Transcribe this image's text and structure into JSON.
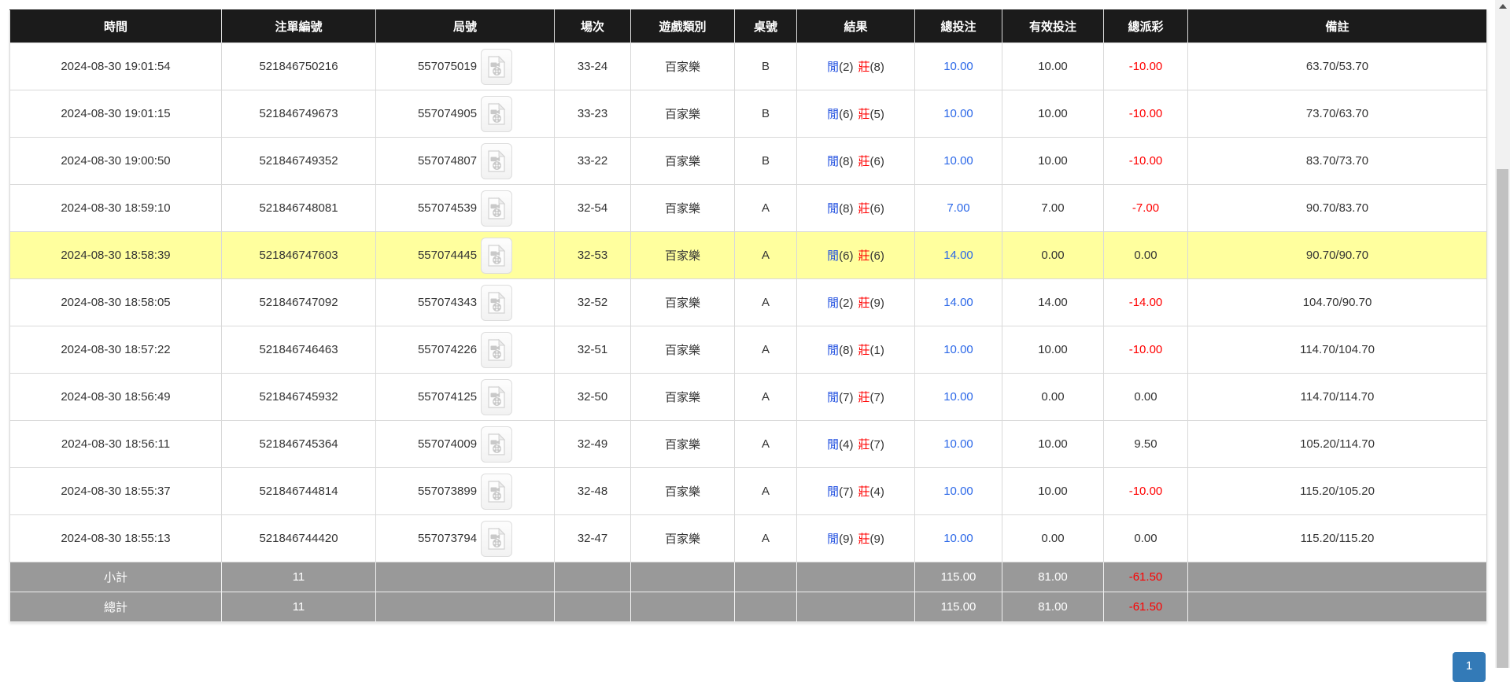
{
  "colors": {
    "header_bg": "#1b1b1b",
    "highlight_yellow": "#ffff9e",
    "bet_blue": "#2c68e8",
    "player_blue": "#2150e0",
    "banker_red": "#ff0000",
    "negative_red": "#ff0000",
    "summary_bg": "#999999",
    "pagination_blue": "#337ab7"
  },
  "icons": {
    "round_video": "video-file-icon",
    "scrollbar_up": "up-arrow-icon"
  },
  "pagination": {
    "current_page": "1"
  },
  "table": {
    "columns": [
      {
        "key": "time",
        "label": "時間"
      },
      {
        "key": "bet_id",
        "label": "注單編號"
      },
      {
        "key": "round",
        "label": "局號"
      },
      {
        "key": "session",
        "label": "場次"
      },
      {
        "key": "game_type",
        "label": "遊戲類別"
      },
      {
        "key": "table_no",
        "label": "桌號"
      },
      {
        "key": "result",
        "label": "結果"
      },
      {
        "key": "total_bet",
        "label": "總投注"
      },
      {
        "key": "valid_bet",
        "label": "有效投注"
      },
      {
        "key": "total_payout",
        "label": "總派彩"
      },
      {
        "key": "remark",
        "label": "備註"
      }
    ],
    "rows": [
      {
        "time": "2024-08-30 19:01:54",
        "bet_id": "521846750216",
        "round": "557075019",
        "session": "33-24",
        "game_type": "百家樂",
        "table_no": "B",
        "result": {
          "player_label": "閒",
          "player": "(2)",
          "banker_label": "莊",
          "banker": "(8)"
        },
        "total_bet": "10.00",
        "valid_bet": "10.00",
        "total_payout": "-10.00",
        "remark": "63.70/53.70",
        "highlighted": false
      },
      {
        "time": "2024-08-30 19:01:15",
        "bet_id": "521846749673",
        "round": "557074905",
        "session": "33-23",
        "game_type": "百家樂",
        "table_no": "B",
        "result": {
          "player_label": "閒",
          "player": "(6)",
          "banker_label": "莊",
          "banker": "(5)"
        },
        "total_bet": "10.00",
        "valid_bet": "10.00",
        "total_payout": "-10.00",
        "remark": "73.70/63.70",
        "highlighted": false
      },
      {
        "time": "2024-08-30 19:00:50",
        "bet_id": "521846749352",
        "round": "557074807",
        "session": "33-22",
        "game_type": "百家樂",
        "table_no": "B",
        "result": {
          "player_label": "閒",
          "player": "(8)",
          "banker_label": "莊",
          "banker": "(6)"
        },
        "total_bet": "10.00",
        "valid_bet": "10.00",
        "total_payout": "-10.00",
        "remark": "83.70/73.70",
        "highlighted": false
      },
      {
        "time": "2024-08-30 18:59:10",
        "bet_id": "521846748081",
        "round": "557074539",
        "session": "32-54",
        "game_type": "百家樂",
        "table_no": "A",
        "result": {
          "player_label": "閒",
          "player": "(8)",
          "banker_label": "莊",
          "banker": "(6)"
        },
        "total_bet": "7.00",
        "valid_bet": "7.00",
        "total_payout": "-7.00",
        "remark": "90.70/83.70",
        "highlighted": false
      },
      {
        "time": "2024-08-30 18:58:39",
        "bet_id": "521846747603",
        "round": "557074445",
        "session": "32-53",
        "game_type": "百家樂",
        "table_no": "A",
        "result": {
          "player_label": "閒",
          "player": "(6)",
          "banker_label": "莊",
          "banker": "(6)"
        },
        "total_bet": "14.00",
        "valid_bet": "0.00",
        "total_payout": "0.00",
        "remark": "90.70/90.70",
        "highlighted": true
      },
      {
        "time": "2024-08-30 18:58:05",
        "bet_id": "521846747092",
        "round": "557074343",
        "session": "32-52",
        "game_type": "百家樂",
        "table_no": "A",
        "result": {
          "player_label": "閒",
          "player": "(2)",
          "banker_label": "莊",
          "banker": "(9)"
        },
        "total_bet": "14.00",
        "valid_bet": "14.00",
        "total_payout": "-14.00",
        "remark": "104.70/90.70",
        "highlighted": false
      },
      {
        "time": "2024-08-30 18:57:22",
        "bet_id": "521846746463",
        "round": "557074226",
        "session": "32-51",
        "game_type": "百家樂",
        "table_no": "A",
        "result": {
          "player_label": "閒",
          "player": "(8)",
          "banker_label": "莊",
          "banker": "(1)"
        },
        "total_bet": "10.00",
        "valid_bet": "10.00",
        "total_payout": "-10.00",
        "remark": "114.70/104.70",
        "highlighted": false
      },
      {
        "time": "2024-08-30 18:56:49",
        "bet_id": "521846745932",
        "round": "557074125",
        "session": "32-50",
        "game_type": "百家樂",
        "table_no": "A",
        "result": {
          "player_label": "閒",
          "player": "(7)",
          "banker_label": "莊",
          "banker": "(7)"
        },
        "total_bet": "10.00",
        "valid_bet": "0.00",
        "total_payout": "0.00",
        "remark": "114.70/114.70",
        "highlighted": false
      },
      {
        "time": "2024-08-30 18:56:11",
        "bet_id": "521846745364",
        "round": "557074009",
        "session": "32-49",
        "game_type": "百家樂",
        "table_no": "A",
        "result": {
          "player_label": "閒",
          "player": "(4)",
          "banker_label": "莊",
          "banker": "(7)"
        },
        "total_bet": "10.00",
        "valid_bet": "10.00",
        "total_payout": "9.50",
        "remark": "105.20/114.70",
        "highlighted": false
      },
      {
        "time": "2024-08-30 18:55:37",
        "bet_id": "521846744814",
        "round": "557073899",
        "session": "32-48",
        "game_type": "百家樂",
        "table_no": "A",
        "result": {
          "player_label": "閒",
          "player": "(7)",
          "banker_label": "莊",
          "banker": "(4)"
        },
        "total_bet": "10.00",
        "valid_bet": "10.00",
        "total_payout": "-10.00",
        "remark": "115.20/105.20",
        "highlighted": false
      },
      {
        "time": "2024-08-30 18:55:13",
        "bet_id": "521846744420",
        "round": "557073794",
        "session": "32-47",
        "game_type": "百家樂",
        "table_no": "A",
        "result": {
          "player_label": "閒",
          "player": "(9)",
          "banker_label": "莊",
          "banker": "(9)"
        },
        "total_bet": "10.00",
        "valid_bet": "0.00",
        "total_payout": "0.00",
        "remark": "115.20/115.20",
        "highlighted": false
      }
    ],
    "summary": [
      {
        "label": "小計",
        "count": "11",
        "total_bet": "115.00",
        "valid_bet": "81.00",
        "total_payout": "-61.50"
      },
      {
        "label": "總計",
        "count": "11",
        "total_bet": "115.00",
        "valid_bet": "81.00",
        "total_payout": "-61.50"
      }
    ]
  }
}
